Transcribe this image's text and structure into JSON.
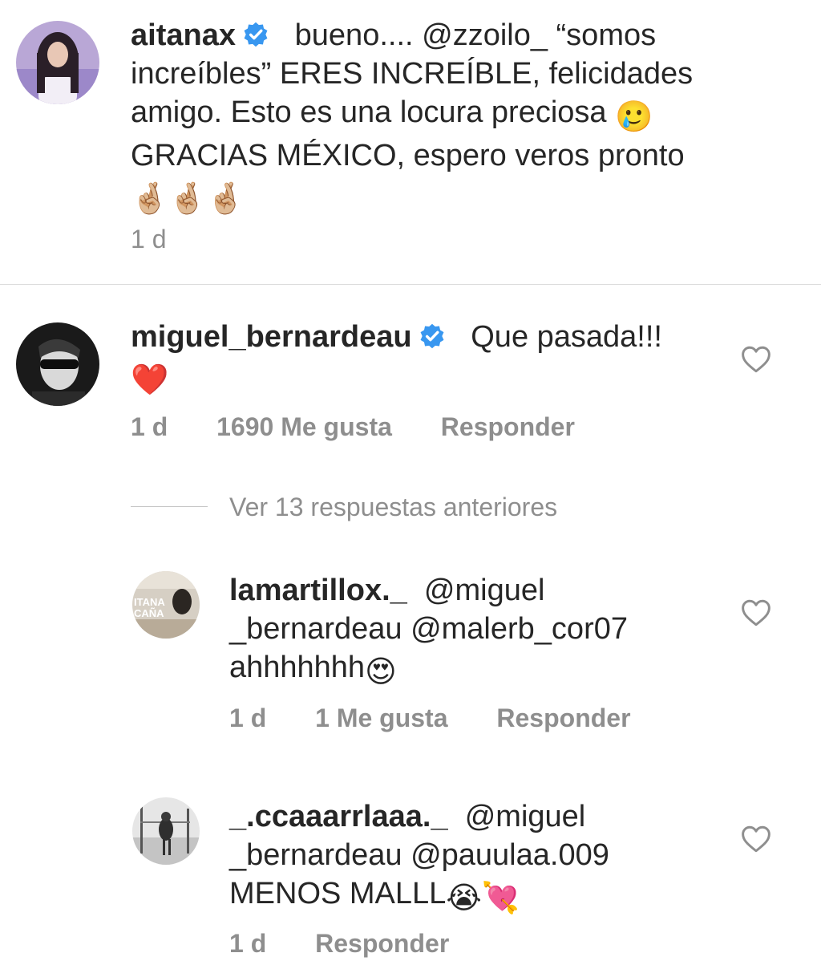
{
  "colors": {
    "text": "#262626",
    "meta": "#8e8e8e",
    "verified_blue": "#3897f0",
    "heart_red": "#ed4956",
    "divider": "#dbdbdb"
  },
  "caption": {
    "username": "aitanax",
    "verified": true,
    "text_part1": "bueno.... @zzoilo_ “somos increíbles” ERES INCREÍBLE, felicidades amigo. Esto es una locura preciosa",
    "emoji_1": "🥲",
    "text_part2": "GRACIAS MÉXICO, espero veros pronto",
    "emoji_2": "🤞🏼🤞🏼🤞🏼",
    "time": "1 d"
  },
  "comments": [
    {
      "username": "miguel_bernardeau",
      "verified": true,
      "text": "Que pasada!!!",
      "emoji": "❤️",
      "time": "1 d",
      "likes": "1690 Me gusta",
      "reply_label": "Responder",
      "like_icon": "heart-outline-icon"
    }
  ],
  "view_replies": "Ver 13 respuestas anteriores",
  "replies": [
    {
      "username": "lamartillox._",
      "text": "@miguel _bernardeau @malerb_cor07 ahhhhhhh",
      "emoji": "😍",
      "time": "1 d",
      "likes": "1 Me gusta",
      "reply_label": "Responder",
      "avatar_text_1": "ITANA",
      "avatar_text_2": "CAÑA",
      "like_icon": "heart-outline-icon"
    },
    {
      "username": "_.ccaaarrlaaa._",
      "text": "@miguel _bernardeau @pauulaa.009 MENOS MALLL",
      "emoji": "😭💘",
      "time": "1 d",
      "reply_label": "Responder",
      "like_icon": "heart-outline-icon"
    }
  ]
}
